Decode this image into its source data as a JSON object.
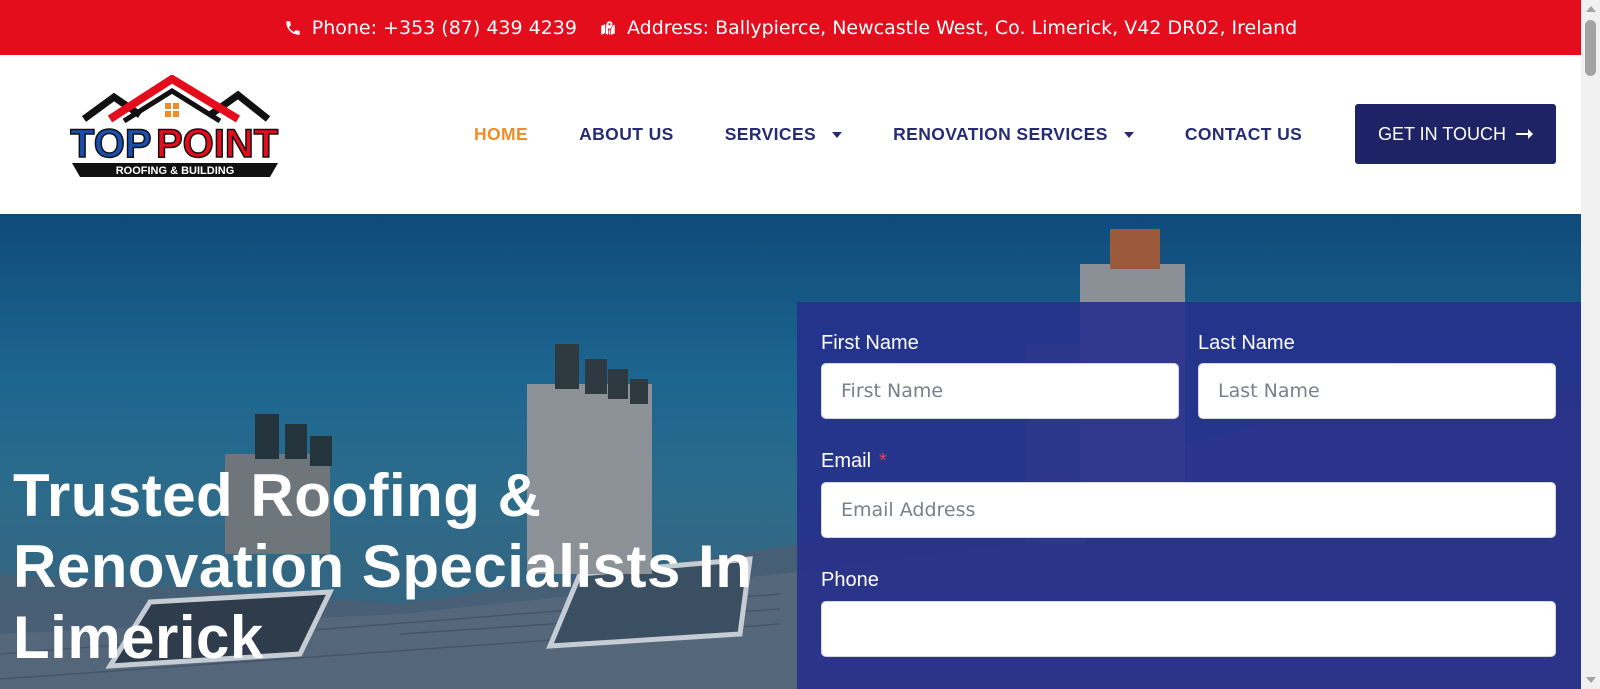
{
  "topbar": {
    "phone": "Phone: +353 (87) 439 4239",
    "address": "Address: Ballypierce, Newcastle West, Co. Limerick, V42 DR02, Ireland"
  },
  "logo": {
    "line1_top": "TOP",
    "line1_point": "POINT",
    "line2": "ROOFING & BUILDING"
  },
  "nav": {
    "items": [
      {
        "label": "HOME",
        "active": true
      },
      {
        "label": "ABOUT US"
      },
      {
        "label": "SERVICES",
        "dropdown": true
      },
      {
        "label": "RENOVATION SERVICES",
        "dropdown": true
      },
      {
        "label": "CONTACT US"
      }
    ],
    "cta": "GET IN TOUCH"
  },
  "hero": {
    "title": "Trusted Roofing & Renovation Specialists In Limerick"
  },
  "form": {
    "first_name": {
      "label": "First Name",
      "placeholder": "First Name",
      "value": ""
    },
    "last_name": {
      "label": "Last Name",
      "placeholder": "Last Name",
      "value": ""
    },
    "email": {
      "label": "Email",
      "required_mark": "*",
      "placeholder": "Email Address",
      "value": ""
    },
    "phone": {
      "label": "Phone",
      "placeholder": "",
      "value": ""
    }
  },
  "colors": {
    "topbar": "#e30d1c",
    "nav_text": "#262c73",
    "nav_active": "#f08c2a",
    "cta_bg": "#1e2366",
    "form_bg": "#26308c"
  },
  "icons": [
    "phone-icon",
    "map-icon",
    "arrow-right-icon",
    "caret-down-icon"
  ]
}
